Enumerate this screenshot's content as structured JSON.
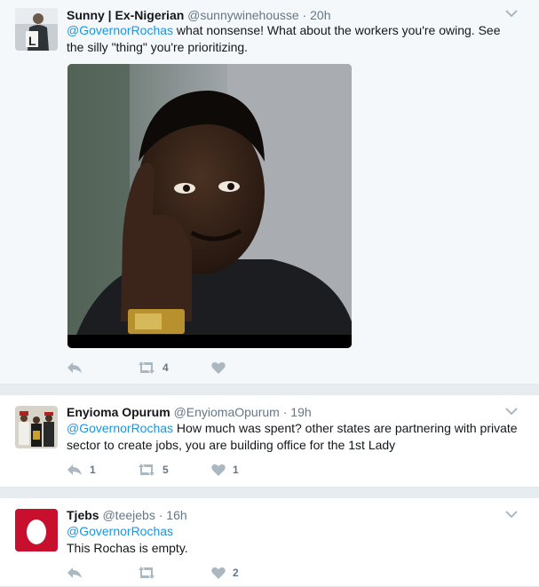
{
  "tweets": [
    {
      "name": "Sunny | Ex-Nigerian",
      "handle": "@sunnywinehousse",
      "dot": "·",
      "time": "20h",
      "mention": "@GovernorRochas",
      "text": " what nonsense! What about the workers you're owing. See the silly \"thing\" you're prioritizing.",
      "reply_count": "",
      "retweet_count": "4",
      "like_count": ""
    },
    {
      "name": "Enyioma Opurum",
      "handle": "@EnyiomaOpurum",
      "dot": "·",
      "time": "19h",
      "mention": "@GovernorRochas",
      "text": " How much was spent? other states are partnering with private sector to create jobs, you are building office for the 1st Lady",
      "reply_count": "1",
      "retweet_count": "5",
      "like_count": "1"
    },
    {
      "name": "Tjebs",
      "handle": "@teejebs",
      "dot": "·",
      "time": "16h",
      "mention": "@GovernorRochas",
      "text": "This Rochas is empty.",
      "reply_count": "",
      "retweet_count": "",
      "like_count": "2"
    }
  ],
  "colors": {
    "accent": "#1b95e0",
    "muted": "#657786",
    "icon": "#aab8c2",
    "egg_red": "#c8102e"
  },
  "icons": {
    "reply": "reply-icon",
    "retweet": "retweet-icon",
    "like": "heart-icon",
    "more": "chevron-down-icon",
    "default_avatar": "egg-icon"
  }
}
